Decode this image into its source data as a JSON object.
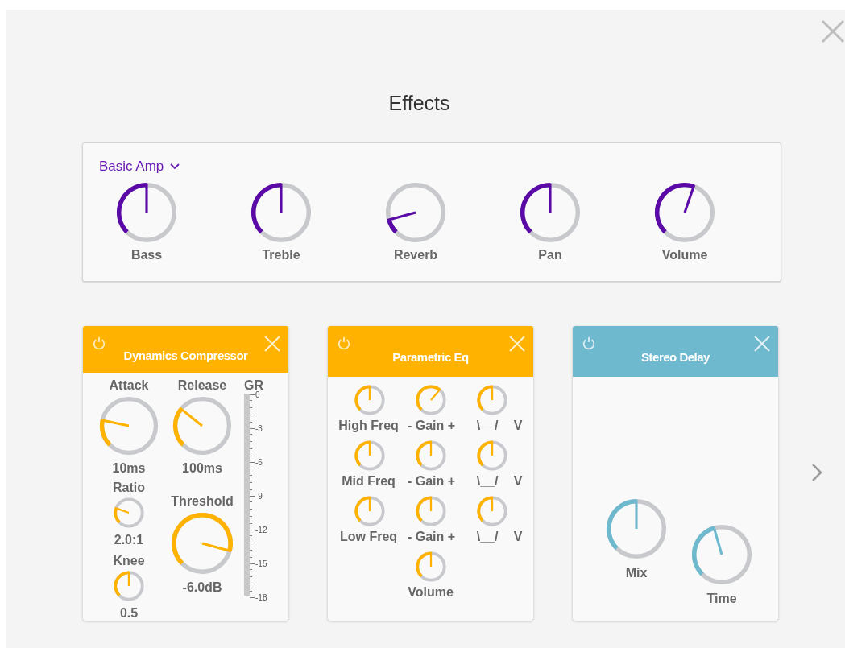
{
  "window": {
    "title": "Effects"
  },
  "amp": {
    "preset": "Basic Amp",
    "knobs": [
      {
        "label": "Bass"
      },
      {
        "label": "Treble"
      },
      {
        "label": "Reverb"
      },
      {
        "label": "Pan"
      },
      {
        "label": "Volume"
      }
    ]
  },
  "effects": [
    {
      "kind": "compressor",
      "title": "Dynamics Compressor",
      "color": "#ffb300",
      "attack": {
        "label": "Attack",
        "value": "10ms"
      },
      "release": {
        "label": "Release",
        "value": "100ms"
      },
      "ratio": {
        "label": "Ratio",
        "value": "2.0:1"
      },
      "knee": {
        "label": "Knee",
        "value": "0.5"
      },
      "threshold": {
        "label": "Threshold",
        "value": "-6.0dB"
      },
      "meter": {
        "label": "GR",
        "scale": [
          "0",
          "-3",
          "-6",
          "-9",
          "-12",
          "-15",
          "-18"
        ]
      }
    },
    {
      "kind": "eq",
      "title": "Parametric Eq",
      "color": "#ffb300",
      "rows": [
        {
          "labels": [
            "High Freq",
            "- Gain +",
            "\\__/",
            "V"
          ]
        },
        {
          "labels": [
            "Mid Freq",
            "- Gain +",
            "\\__/",
            "V"
          ]
        },
        {
          "labels": [
            "Low Freq",
            "- Gain +",
            "\\__/",
            "V"
          ]
        }
      ],
      "volume": {
        "label": "Volume"
      }
    },
    {
      "kind": "delay",
      "title": "Stereo Delay",
      "color": "#6fb9cf",
      "mix": {
        "label": "Mix"
      },
      "time": {
        "label": "Time"
      }
    }
  ]
}
